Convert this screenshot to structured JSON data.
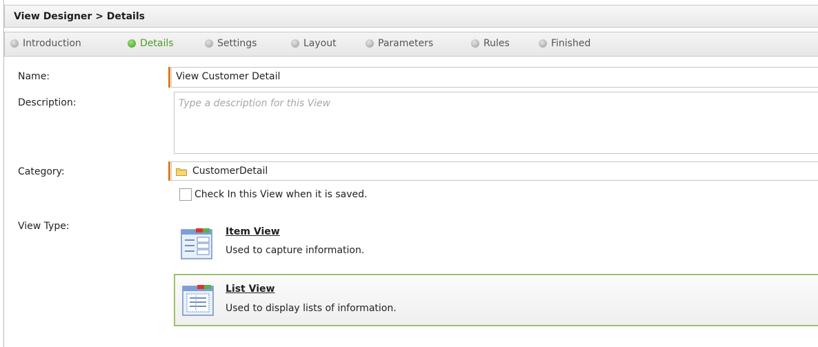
{
  "window": {
    "title": "View Designer > Details"
  },
  "steps": [
    {
      "label": "Introduction",
      "active": false
    },
    {
      "label": "Details",
      "active": true
    },
    {
      "label": "Settings",
      "active": false
    },
    {
      "label": "Layout",
      "active": false
    },
    {
      "label": "Parameters",
      "active": false
    },
    {
      "label": "Rules",
      "active": false
    },
    {
      "label": "Finished",
      "active": false
    }
  ],
  "form": {
    "name_label": "Name:",
    "name_value": "View Customer Detail",
    "description_label": "Description:",
    "description_placeholder": "Type a description for this View",
    "category_label": "Category:",
    "category_value": "CustomerDetail",
    "checkin_label": "Check In this View when it is saved.",
    "view_type_label": "View Type:"
  },
  "view_types": [
    {
      "title": "Item View",
      "description": "Used to capture information.",
      "selected": false
    },
    {
      "title": "List View",
      "description": "Used to display lists of information.",
      "selected": true
    }
  ],
  "colors": {
    "active_step": "#4f9a25",
    "required_accent": "#e07b14",
    "selected_border": "#9cc26b"
  }
}
